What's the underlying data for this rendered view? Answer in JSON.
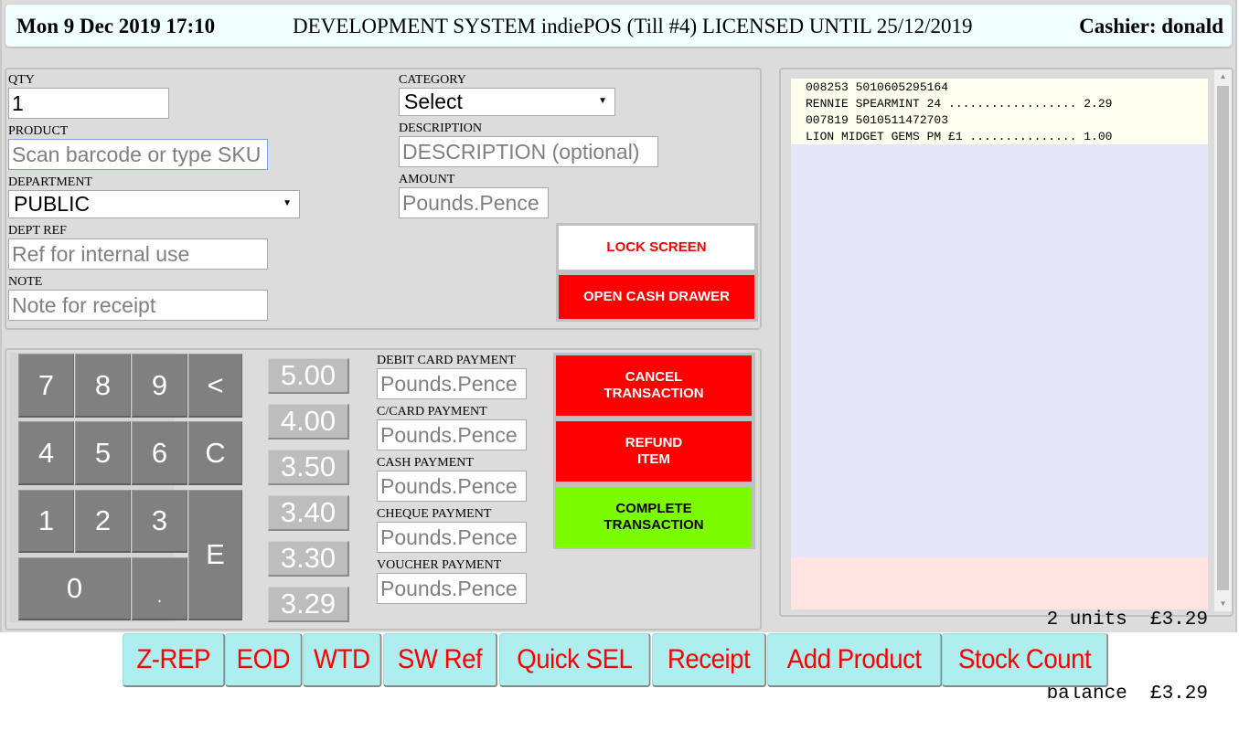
{
  "header": {
    "datetime": "Mon 9 Dec 2019 17:10",
    "title": "DEVELOPMENT SYSTEM indiePOS (Till #4) LICENSED UNTIL 25/12/2019",
    "cashier": "Cashier: donald"
  },
  "entry": {
    "qty": {
      "label": "QTY",
      "value": "1"
    },
    "product": {
      "label": "PRODUCT",
      "placeholder": "Scan barcode or type SKU"
    },
    "department": {
      "label": "DEPARTMENT",
      "selected": "PUBLIC"
    },
    "dept_ref": {
      "label": "DEPT REF",
      "placeholder": "Ref for internal use"
    },
    "note": {
      "label": "NOTE",
      "placeholder": "Note for receipt"
    },
    "category": {
      "label": "CATEGORY",
      "selected": "Select"
    },
    "description": {
      "label": "DESCRIPTION",
      "placeholder": "DESCRIPTION (optional)"
    },
    "amount": {
      "label": "AMOUNT",
      "placeholder": "Pounds.Pence"
    },
    "lock_screen": "LOCK SCREEN",
    "open_cash_drawer": "OPEN CASH DRAWER"
  },
  "keypad": {
    "keys": [
      "7",
      "8",
      "9",
      "<",
      "4",
      "5",
      "6",
      "C",
      "1",
      "2",
      "3",
      "E",
      "0",
      "."
    ]
  },
  "quick_amounts": [
    "5.00",
    "4.00",
    "3.50",
    "3.40",
    "3.30",
    "3.29"
  ],
  "payments": [
    {
      "label": "DEBIT CARD PAYMENT",
      "placeholder": "Pounds.Pence"
    },
    {
      "label": "C/CARD PAYMENT",
      "placeholder": "Pounds.Pence"
    },
    {
      "label": "CASH PAYMENT",
      "placeholder": "Pounds.Pence"
    },
    {
      "label": "CHEQUE PAYMENT",
      "placeholder": "Pounds.Pence"
    },
    {
      "label": "VOUCHER PAYMENT",
      "placeholder": "Pounds.Pence"
    }
  ],
  "actions": {
    "cancel": "CANCEL\nTRANSACTION",
    "refund": "REFUND\nITEM",
    "complete": "COMPLETE\nTRANSACTION"
  },
  "receipt": {
    "lines": [
      "008253 5010605295164",
      "RENNIE SPEARMINT 24 .................. 2.29",
      "007819 5010511472703",
      "LION MIDGET GEMS PM £1 ............... 1.00"
    ],
    "units_line": "2 units  £3.29",
    "balance_line": "balance  £3.29"
  },
  "function_bar": [
    "Z-REP",
    "EOD",
    "WTD",
    "SW Ref",
    "Quick SEL",
    "Receipt",
    "Add Product",
    "Stock Count"
  ],
  "colors": {
    "header_bg": "#f0ffff",
    "danger": "#ff0000",
    "success": "#7cfc00",
    "function_bg": "#afeeee",
    "receipt_items_bg": "#fffff0",
    "receipt_body_bg": "#e6e6fa",
    "receipt_total_bg": "#ffe4e1"
  }
}
